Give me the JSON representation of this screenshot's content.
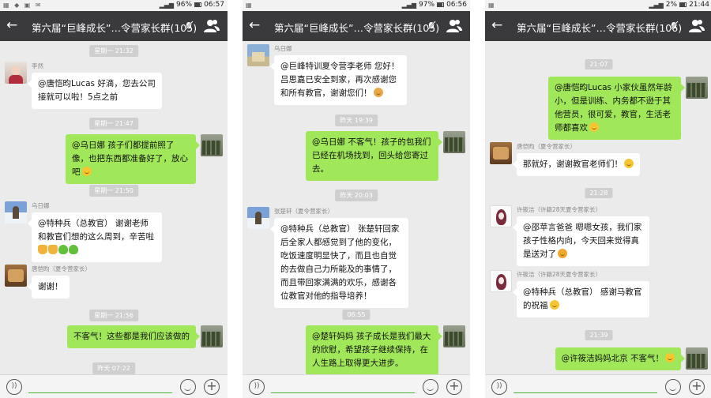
{
  "status": [
    {
      "battery": "96%",
      "time": "06:57"
    },
    {
      "battery": "97%",
      "time": "06:56"
    },
    {
      "battery": "2%",
      "time": "21:44"
    }
  ],
  "titles": [
    "第六届“巨峰成长”…令营家长群(105)",
    "第六届“巨峰成长”…令营家长群(105)",
    "第六届“巨峰成长”…令营家长群(106)"
  ],
  "icons": {
    "back": "arrow-left-icon",
    "mute": "mute-bell-icon",
    "members": "group-members-icon",
    "voice": "voice-input-icon",
    "emoji": "emoji-icon",
    "more": "plus-icon"
  },
  "colors": {
    "titlebar": "#3a3a3d",
    "bubble_self": "#a0e759",
    "bubble_other": "#ffffff",
    "chat_bg": "#ebebeb"
  },
  "panel0": {
    "ts1": "星期一 21:32",
    "m1_name": "李然",
    "m1_text": "@唐恺昀Lucas 好滴，您去公司接就可以啦！5点之前",
    "ts2": "星期一 21:47",
    "m2_text": "@乌日娜 孩子们都提前照了像，也把东西都准备好了，放心吧",
    "ts3": "星期一 21:50",
    "m3_name": "乌日娜",
    "m3_text": "@特种兵（总教官） 谢谢老师和教官们想的这么周到，辛苦啦",
    "m4_name": "唐恺昀（夏令营家长）",
    "m4_text": "谢谢！",
    "ts4": "星期一 21:56",
    "m5_text": "不客气！这些都是我们应该做的",
    "ts5": "昨天 07:22"
  },
  "panel1": {
    "m1_name": "乌日娜",
    "m1_text": "@巨峰特训夏令营李老师 您好！吕思嘉已安全到家，再次感谢您和所有教官，谢谢您们！",
    "ts1": "昨天 19:39",
    "m2_text": "@乌日娜 不客气！孩子的包我们已经在机场找到，回头给您寄过去。",
    "ts2": "昨天 20:03",
    "m3_name": "张楚轩（夏令营家长）",
    "m3_text": "@特种兵（总教官） 张楚轩回家后全家人都感觉到了他的变化，吃饭速度明显快了，而且也自觉的去做自己力所能及的事情了，而且带回家满满的欢乐，感谢各位教官对他的指导培养！",
    "ts3": "06:55",
    "m4_text": "@楚轩妈妈 孩子成长是我们最大的欣慰，希望孩子继续保持，在人生路上取得更大进步。"
  },
  "panel2": {
    "ts1": "21:07",
    "m1_text": "@唐恺昀Lucas 小家伙虽然年龄小，但是训练、内务都不逊于其他营员，很可爱，教官，生活老师都喜欢",
    "m2_name": "唐恺昀（夏令营家长）",
    "m2_text": "那就好，谢谢教官老师们！",
    "ts2": "21:28",
    "m3_name": "许筱洁（许籍28天夏令营家长）",
    "m3_text": "@邵苹言爸爸 嗯嗯女孩，我们家孩子性格内向，今天回来觉得真是送对了",
    "m4_name": "许筱洁（许籍28天夏令营家长）",
    "m4_text": "@特种兵（总教官） 感谢马教官的祝福",
    "ts3": "21:39",
    "m5_text": "@许筱洁妈妈北京 不客气！"
  }
}
